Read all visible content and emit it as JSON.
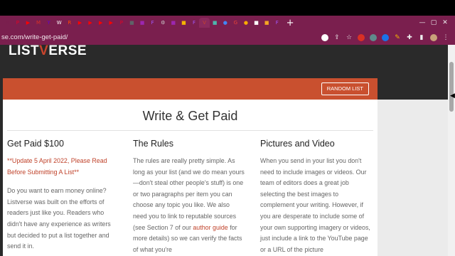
{
  "browser": {
    "tabs": [
      {
        "icon": "close-icon",
        "glyph": "✕",
        "color": "#7a1f4e"
      },
      {
        "icon": "pinterest-icon",
        "glyph": "P",
        "color": "#e60023"
      },
      {
        "icon": "youtube-icon",
        "glyph": "▶",
        "color": "#ff0000"
      },
      {
        "icon": "gmail-icon",
        "glyph": "M",
        "color": "#d93025"
      },
      {
        "icon": "yahoo-icon",
        "glyph": "Y",
        "color": "#6001d2"
      },
      {
        "icon": "wiki-icon",
        "glyph": "W",
        "color": "#ffffff"
      },
      {
        "icon": "reddit-icon",
        "glyph": "R",
        "color": "#ff4500"
      },
      {
        "icon": "youtube-icon",
        "glyph": "▶",
        "color": "#ff0000"
      },
      {
        "icon": "youtube-icon",
        "glyph": "▶",
        "color": "#ff0000"
      },
      {
        "icon": "youtube-icon",
        "glyph": "▶",
        "color": "#ff0000"
      },
      {
        "icon": "youtube-icon",
        "glyph": "▶",
        "color": "#ff0000"
      },
      {
        "icon": "pinterest-icon",
        "glyph": "P",
        "color": "#e60023"
      },
      {
        "icon": "page-icon",
        "glyph": "■",
        "color": "#5f6368"
      },
      {
        "icon": "photo-icon",
        "glyph": "■",
        "color": "#9c27b0"
      },
      {
        "icon": "figma-icon",
        "glyph": "F",
        "color": "#a259ff"
      },
      {
        "icon": "settings-icon",
        "glyph": "⚙",
        "color": "#cccccc"
      },
      {
        "icon": "photo-icon",
        "glyph": "■",
        "color": "#9c27b0"
      },
      {
        "icon": "folder-icon",
        "glyph": "■",
        "color": "#f4b400"
      },
      {
        "icon": "figma-icon",
        "glyph": "F",
        "color": "#a259ff"
      },
      {
        "icon": "listverse-icon",
        "glyph": "V",
        "color": "#c9442c",
        "active": true
      },
      {
        "icon": "page-icon",
        "glyph": "■",
        "color": "#4db6ac"
      },
      {
        "icon": "chrome-icon",
        "glyph": "●",
        "color": "#4285f4"
      },
      {
        "icon": "google-icon",
        "glyph": "G",
        "color": "#ea4335"
      },
      {
        "icon": "lightbulb-icon",
        "glyph": "●",
        "color": "#f9ab00"
      },
      {
        "icon": "doc-icon",
        "glyph": "■",
        "color": "#ffffff"
      },
      {
        "icon": "page-icon",
        "glyph": "■",
        "color": "#f5a623"
      },
      {
        "icon": "figma-icon",
        "glyph": "F",
        "color": "#a259ff"
      }
    ],
    "new_tab_label": "+",
    "url": "se.com/write-get-paid/",
    "window_controls": [
      "—",
      "▢",
      "✕"
    ]
  },
  "site": {
    "logo_pre": "LIST",
    "logo_v": "V",
    "logo_post": "ERSE",
    "random_button": "RANDOM LIST"
  },
  "page": {
    "title": "Write & Get Paid",
    "columns": [
      {
        "heading": "Get Paid $100",
        "note": "**Update 5 April 2022, Please Read Before Submitting A List**",
        "body": "Do you want to earn money online? Listverse was built on the efforts of readers just like you. Readers who didn't have any experience as writers but decided to put a list together and send it in."
      },
      {
        "heading": "The Rules",
        "body_before": "The rules are really pretty simple. As long as your list (and we do mean yours—don't steal other people's stuff) is one or two paragraphs per item you can choose any topic you like. We also need you to link to reputable sources (see Section 7 of our ",
        "link": "author guide",
        "body_after": " for more details) so we can verify the facts of what you're"
      },
      {
        "heading": "Pictures and Video",
        "body": "When you send in your list you don't need to include images or videos. Our team of editors does a great job selecting the best images to complement your writing. However, if you are desperate to include some of your own supporting imagery or videos, just include a link to the YouTube page or a URL of the picture"
      }
    ]
  }
}
